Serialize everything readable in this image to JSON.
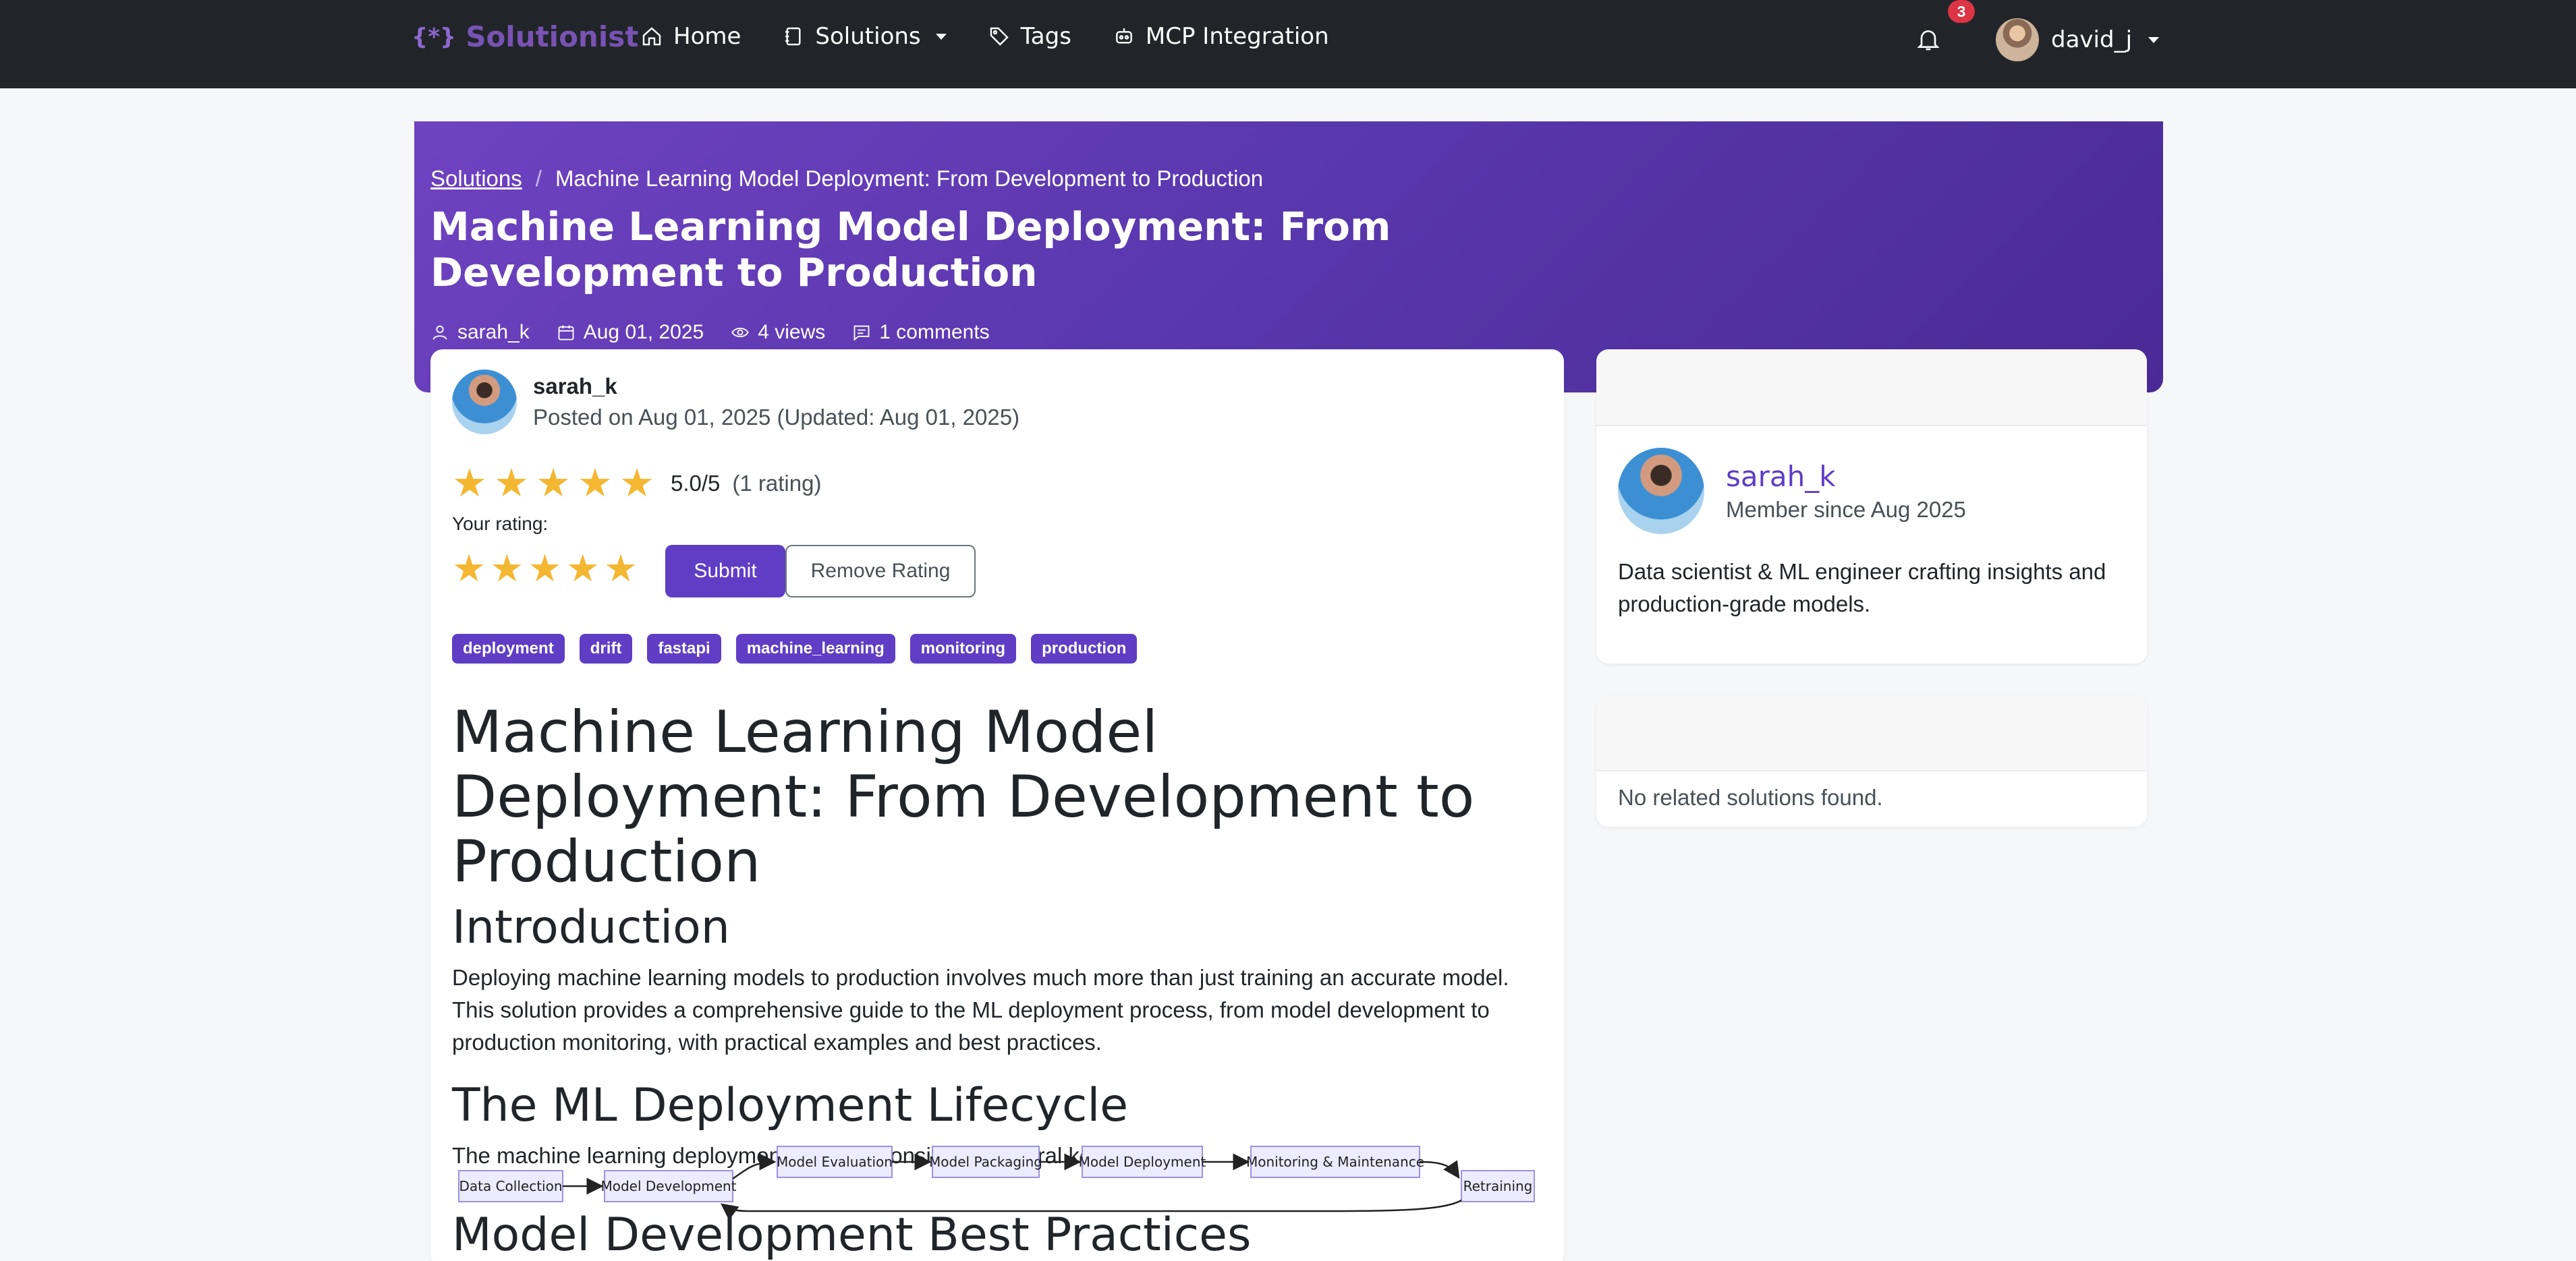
{
  "navbar": {
    "brand": "Solutionist",
    "brand_icon": "{*}",
    "items": [
      {
        "label": "Home",
        "icon": "home-icon"
      },
      {
        "label": "Solutions",
        "icon": "journal-icon",
        "dropdown": true
      },
      {
        "label": "Tags",
        "icon": "tag-icon"
      },
      {
        "label": "MCP Integration",
        "icon": "robot-icon"
      }
    ],
    "notification_count": "3",
    "username": "david_j"
  },
  "breadcrumb": {
    "root": "Solutions",
    "separator": "/",
    "current": "Machine Learning Model Deployment: From Development to Production"
  },
  "hero": {
    "title": "Machine Learning Model Deployment: From Development to Production",
    "author": "sarah_k",
    "date": "Aug 01, 2025",
    "views": "4 views",
    "comments": "1 comments"
  },
  "post": {
    "author": "sarah_k",
    "posted": "Posted on Aug 01, 2025 (Updated: Aug 01, 2025)",
    "rating_score": "5.0/5",
    "rating_count": "(1 rating)",
    "your_rating_label": "Your rating:",
    "submit_label": "Submit",
    "remove_label": "Remove Rating",
    "tags": [
      "deployment",
      "drift",
      "fastapi",
      "machine_learning",
      "monitoring",
      "production"
    ]
  },
  "article": {
    "h1": "Machine Learning Model Deployment: From Development to Production",
    "intro_heading": "Introduction",
    "intro_text": "Deploying machine learning models to production involves much more than just training an accurate model. This solution provides a comprehensive guide to the ML deployment process, from model development to production monitoring, with practical examples and best practices.",
    "lifecycle_heading": "The ML Deployment Lifecycle",
    "lifecycle_text": "The machine learning deployment lifecycle consists of several key stages:",
    "diagram_nodes": [
      "Data Collection",
      "Model Development",
      "Model Evaluation",
      "Model Packaging",
      "Model Deployment",
      "Monitoring & Maintenance",
      "Retraining"
    ],
    "next_heading": "Model Development Best Practices"
  },
  "sidebar": {
    "author_name": "sarah_k",
    "member_since": "Member since Aug 2025",
    "bio": "Data scientist & ML engineer crafting insights and production-grade models.",
    "related_empty": "No related solutions found."
  },
  "colors": {
    "navbar_bg": "#212529",
    "accent": "#5f3dc4",
    "hero_gradient_start": "#6f42c1",
    "hero_gradient_end": "#4b2a96",
    "star": "#f4b731",
    "badge": "#dc3545"
  }
}
